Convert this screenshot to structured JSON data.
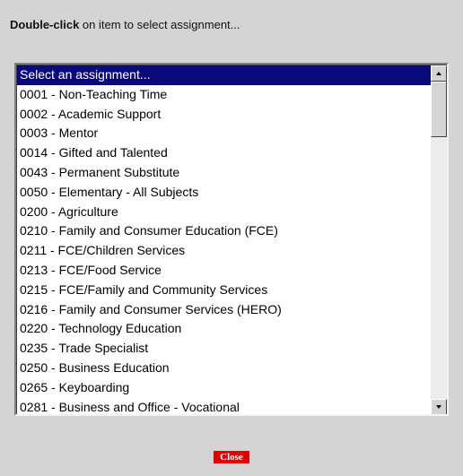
{
  "instruction": {
    "bold": "Double-click",
    "rest": " on item to select assignment..."
  },
  "listbox": {
    "items": [
      "Select an assignment...",
      "0001 - Non-Teaching Time",
      "0002 - Academic Support",
      "0003 - Mentor",
      "0014 - Gifted and Talented",
      "0043 - Permanent Substitute",
      "0050 - Elementary - All Subjects",
      "0200 - Agriculture",
      "0210 - Family and Consumer Education (FCE)",
      "0211 - FCE/Children Services",
      "0213 - FCE/Food Service",
      "0215 - FCE/Family and Community Services",
      "0216 - Family and Consumer Services (HERO)",
      "0220 - Technology Education",
      "0235 - Trade Specialist",
      "0250 - Business Education",
      "0265 - Keyboarding",
      "0281 - Business and Office - Vocational"
    ],
    "selected_index": 0
  },
  "close_button": {
    "label": "Close"
  },
  "colors": {
    "selection": "#0a0a7a",
    "close_button": "#e00000",
    "background": "#d4d4d4"
  },
  "icons": {
    "scroll_up": "arrow-up-icon",
    "scroll_down": "arrow-down-icon"
  }
}
